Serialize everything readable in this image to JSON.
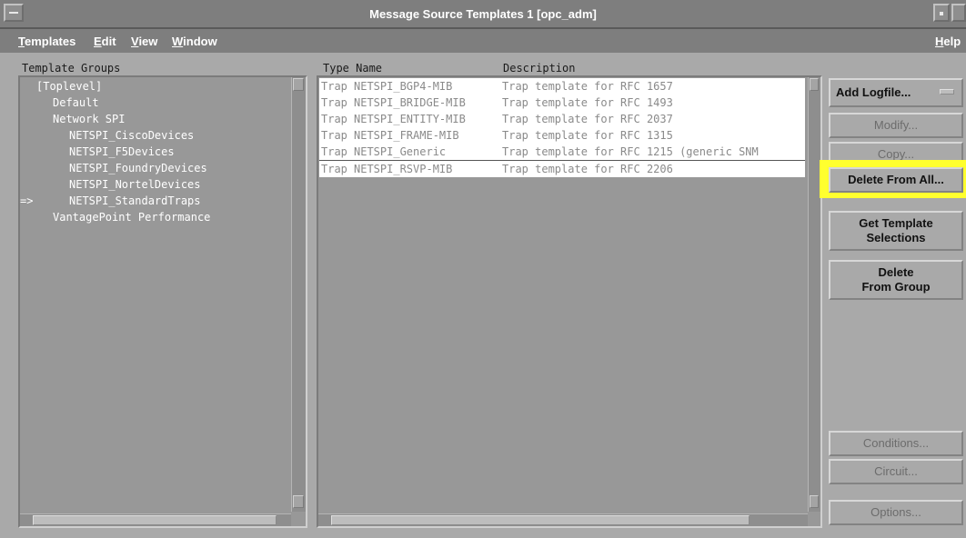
{
  "window": {
    "title": "Message Source Templates  1 [opc_adm]"
  },
  "menubar": {
    "templates": "Templates",
    "edit": "Edit",
    "view": "View",
    "window": "Window",
    "help": "Help"
  },
  "groups": {
    "header": "Template Groups",
    "pointer": "=>",
    "items": [
      "[Toplevel]",
      "Default",
      "Network SPI",
      "NETSPI_CiscoDevices",
      "NETSPI_F5Devices",
      "NETSPI_FoundryDevices",
      "NETSPI_NortelDevices",
      "NETSPI_StandardTraps",
      "VantagePoint Performance"
    ]
  },
  "templates": {
    "col_type_name": "Type Name",
    "col_description": "Description",
    "rows": [
      {
        "type": "Trap",
        "name": "NETSPI_BGP4-MIB",
        "description": "Trap template for RFC 1657"
      },
      {
        "type": "Trap",
        "name": "NETSPI_BRIDGE-MIB",
        "description": "Trap template for RFC 1493"
      },
      {
        "type": "Trap",
        "name": "NETSPI_ENTITY-MIB",
        "description": "Trap template for RFC 2037"
      },
      {
        "type": "Trap",
        "name": "NETSPI_FRAME-MIB",
        "description": "Trap template for RFC 1315"
      },
      {
        "type": "Trap",
        "name": "NETSPI_Generic",
        "description": "Trap template for RFC 1215 (generic SNM"
      },
      {
        "type": "Trap",
        "name": "NETSPI_RSVP-MIB",
        "description": "Trap template for RFC 2206"
      }
    ]
  },
  "actions": {
    "add_logfile": "Add Logfile...",
    "modify": "Modify...",
    "copy": "Copy...",
    "delete_from_all": "Delete From All...",
    "get_template_line1": "Get Template",
    "get_template_line2": "Selections",
    "delete_group_line1": "Delete",
    "delete_group_line2": "From Group",
    "conditions": "Conditions...",
    "circuit": "Circuit...",
    "options": "Options..."
  },
  "colors": {
    "highlight": "#ffff2e",
    "title_bar": "#7e7e7e",
    "background": "#a9a9a9"
  }
}
